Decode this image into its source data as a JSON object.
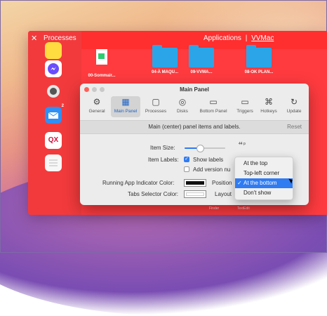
{
  "dock": {
    "title": "Processes",
    "close_glyph": "✕",
    "tabs": {
      "applications": "Applications",
      "separator": "|",
      "vvmac": "VVMac"
    },
    "sidebar_apps": [
      {
        "icon": "cube-app-icon",
        "color": "#ffdd40"
      },
      {
        "icon": "messenger-icon",
        "color": "#ffffff"
      },
      {
        "icon": "bug-app-icon",
        "color": "#f23a3c"
      },
      {
        "icon": "mail-icon",
        "color": "#2f8ff5",
        "badge": "2"
      },
      {
        "icon": "qx-app-icon",
        "color": "#ffffff",
        "label": "QX"
      },
      {
        "icon": "notes-icon",
        "color": "#f7f7f7"
      }
    ],
    "files": [
      {
        "name": "00-Sommair...",
        "icon": "spreadsheet-icon"
      },
      {
        "name": "04-À MAQU...",
        "icon": "folder-icon"
      },
      {
        "name": "09-VVMA...",
        "icon": "folder-icon"
      },
      {
        "name": "08-OK PLAN...",
        "icon": "folder-icon"
      }
    ],
    "bottom_labels": [
      "Finder",
      "TextEdit"
    ]
  },
  "panel": {
    "title": "Main Panel",
    "toolbar": [
      {
        "label": "General",
        "icon": "gear-icon"
      },
      {
        "label": "Main Panel",
        "icon": "grid-icon",
        "selected": true
      },
      {
        "label": "Processes",
        "icon": "chip-icon"
      },
      {
        "label": "Disks",
        "icon": "disk-icon"
      },
      {
        "label": "Bottom Panel",
        "icon": "panel-icon"
      },
      {
        "label": "Triggers",
        "icon": "trigger-icon"
      },
      {
        "label": "Hotkeys",
        "icon": "hotkey-icon"
      },
      {
        "label": "Update",
        "icon": "refresh-icon"
      }
    ],
    "description": "Main (center) panel items and labels.",
    "reset": "Reset",
    "item_size_label": "Item Size:",
    "item_size_value": "44 p",
    "item_labels_label": "Item Labels:",
    "show_labels": "Show labels",
    "add_version": "Add version nu",
    "running_color_label": "Running App Indicator Color:",
    "position_label": "Position",
    "tabs_color_label": "Tabs Selector Color:",
    "layout_label": "Layout"
  },
  "dropdown": {
    "options": [
      "At the top",
      "Top-left corner",
      "At the bottom",
      "Don't show"
    ],
    "selected": "At the bottom"
  },
  "colors": {
    "accent": "#2f7bf2",
    "dock": "#ff3b3f"
  }
}
